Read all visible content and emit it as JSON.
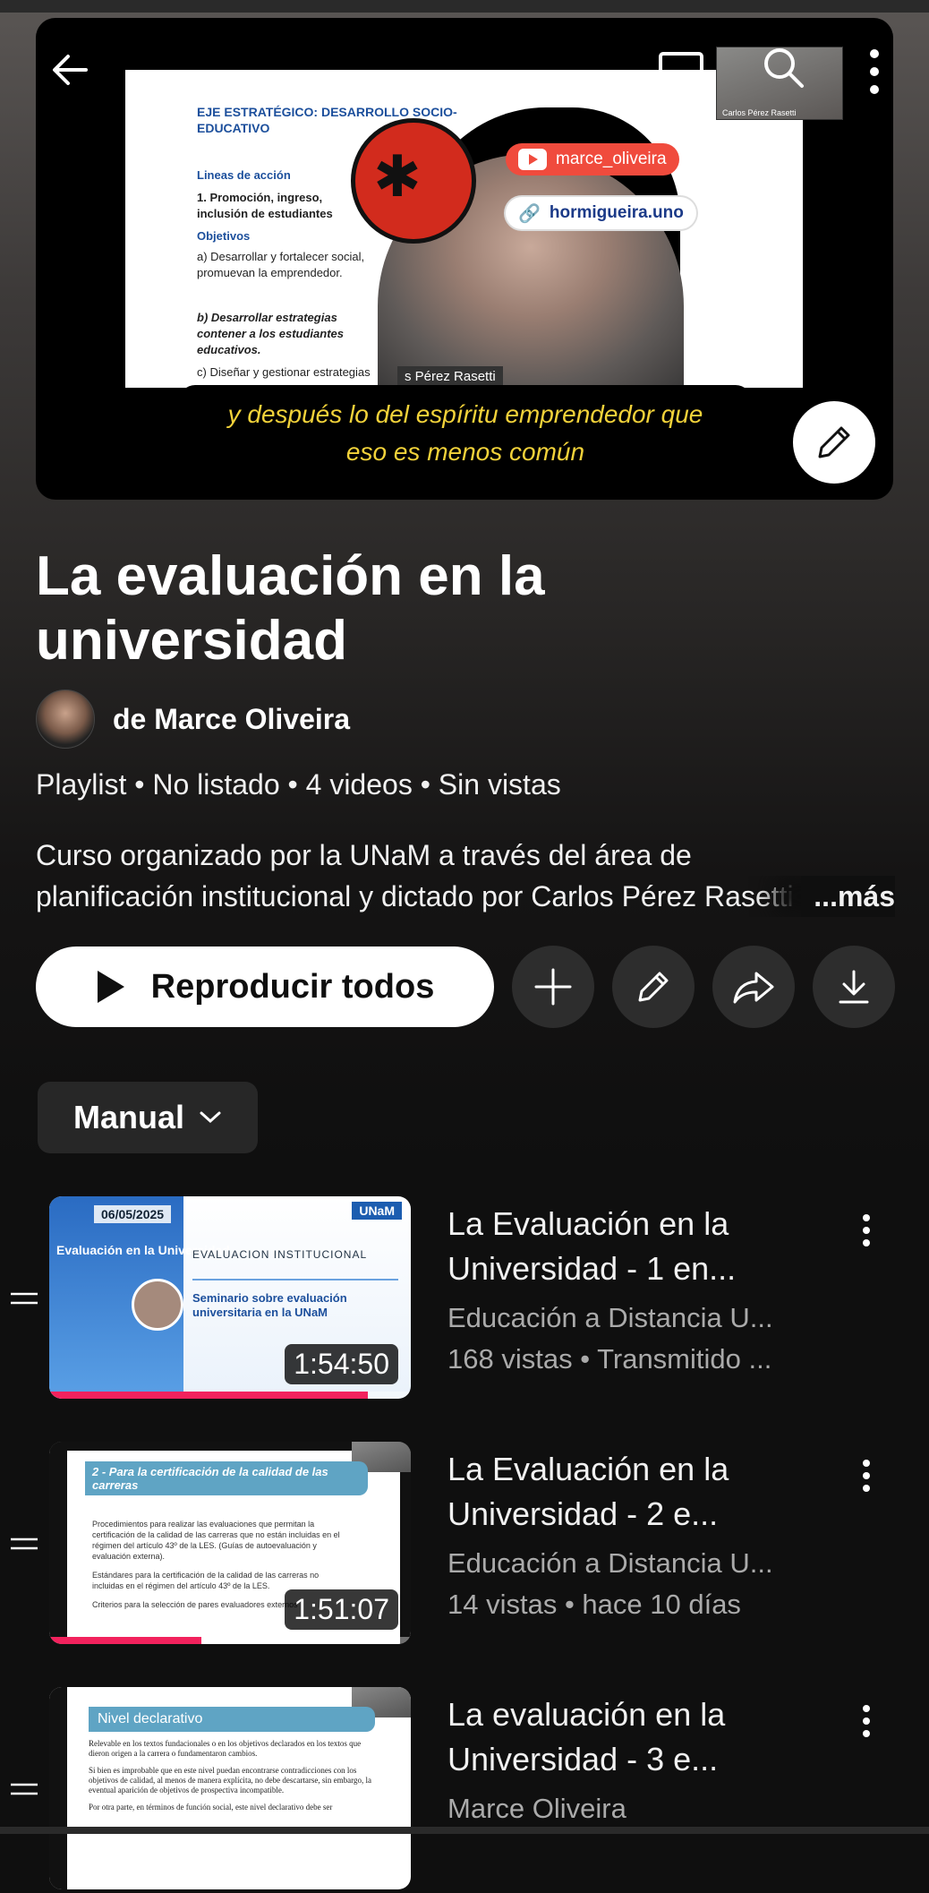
{
  "hero": {
    "slide_title": "EJE ESTRATÉGICO: DESARROLLO SOCIO-EDUCATIVO",
    "slide_lineas": "Lineas de acción",
    "slide_item1": "1.  Promoción, ingreso, inclusión de estudiantes",
    "slide_objetivos": "Objetivos",
    "slide_a": "a)  Desarrollar y fortalecer social, promuevan la emprendedor.",
    "slide_b": "b)  Desarrollar estrategias contener a los estudiantes educativos.",
    "slide_c": "c)  Diseñar y gestionar estrategias",
    "youtube_handle": "marce_oliveira",
    "link_text": "hormigueira.uno",
    "speaker_tag": "s Pérez Rasetti",
    "cam_caption": "Carlos Pérez Rasetti",
    "subtitle_line1": "y después lo del espíritu emprendedor que",
    "subtitle_line2": "eso es menos común"
  },
  "playlist": {
    "title": "La evaluación en la universidad",
    "owner": "de Marce Oliveira",
    "meta": "Playlist • No listado • 4 videos • Sin vistas",
    "description_line1": "Curso organizado por la UNaM a través del área de",
    "description_line2": "planificación institucional y dictado por Carlos Pérez Rasetti",
    "more": "...más",
    "play_all": "Reproducir todos",
    "sort": "Manual"
  },
  "videos": [
    {
      "title": "La Evaluación en la Universidad - 1 en...",
      "channel": "Educación a Distancia U...",
      "stats": "168 vistas • Transmitido ...",
      "duration": "1:54:50",
      "progress": 0.88,
      "thumb": {
        "date": "06/05/2025",
        "badge": "UNaM",
        "side": "Evaluación en la Universidad",
        "header": "EVALUACION INSTITUCIONAL",
        "seminar": "Seminario sobre evaluación universitaria en la UNaM"
      }
    },
    {
      "title": "La Evaluación en la Universidad - 2 e...",
      "channel": "Educación a Distancia U...",
      "stats": "14 vistas • hace 10 días",
      "duration": "1:51:07",
      "progress": 0.42,
      "thumb": {
        "head": "2 - Para la certificación de la calidad de las carreras",
        "p1": "Procedimientos para realizar las evaluaciones que permitan la certificación de la calidad de las carreras que no están incluidas en el régimen del artículo 43º de la LES. (Guías de autoevaluación y evaluación externa).",
        "p2": "Estándares para la certificación de la calidad de las carreras no incluidas en el régimen del artículo 43º de la LES.",
        "p3": "Criterios para la selección de pares evaluadores externos"
      }
    },
    {
      "title": "La evaluación en la Universidad - 3 e...",
      "channel": "Marce Oliveira",
      "stats": "",
      "duration": "",
      "progress": 0,
      "thumb": {
        "head": "Nivel declarativo",
        "p1": "Relevable en los textos fundacionales o en los objetivos declarados en los textos que dieron origen a la carrera o fundamentaron cambios.",
        "p2": "Si bien es improbable que en este nivel puedan encontrarse contradicciones con los objetivos de calidad, al menos de manera explícita, no debe descartarse, sin embargo, la eventual aparición de objetivos de prospectiva incompatible.",
        "p3": "Por otra parte, en términos de función social, este nivel declarativo debe ser"
      }
    }
  ],
  "icons": {
    "back": "arrow-left-icon",
    "cast": "cast-icon",
    "search": "search-icon",
    "more": "more-vert-icon",
    "edit": "pencil-icon",
    "add": "plus-icon",
    "share": "share-icon",
    "download": "download-icon",
    "drag": "drag-handle-icon",
    "play": "play-icon",
    "chevron": "chevron-down-icon"
  },
  "colors": {
    "background": "#0f0f0f",
    "progress": "#f2225d",
    "subtitle": "#f2d23a",
    "chip": "#272727"
  }
}
